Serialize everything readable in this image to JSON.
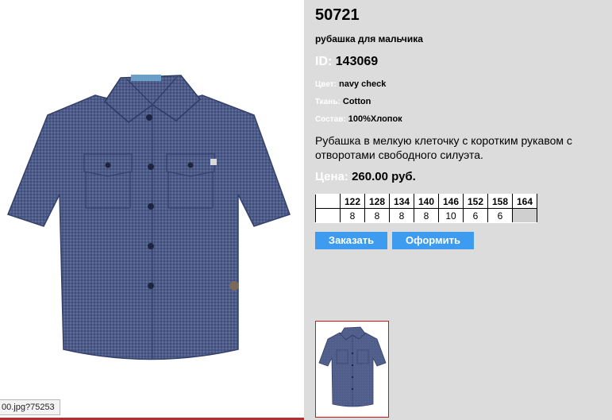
{
  "product": {
    "article": "50721",
    "name": "рубашка для мальчика",
    "id_label": "ID:",
    "id_value": "143069",
    "color_label": "Цвет:",
    "color_value": "navy check",
    "fabric_label": "Ткань:",
    "fabric_value": "Cotton",
    "composition_label": "Состав:",
    "composition_value": "100%Хлопок",
    "description": "Рубашка в мелкую клеточку с коротким рукавом с отворотами свободного силуэта.",
    "price_label": "Цена:",
    "price_value": "260.00 руб."
  },
  "sizes": {
    "headers": [
      "122",
      "128",
      "134",
      "140",
      "146",
      "152",
      "158",
      "164"
    ],
    "quantities": [
      "8",
      "8",
      "8",
      "8",
      "10",
      "6",
      "6",
      ""
    ]
  },
  "actions": {
    "order_label": "Заказать",
    "checkout_label": "Оформить"
  },
  "status_bar": {
    "url": "00.jpg?75253"
  },
  "colors": {
    "panel_bg": "#dcdcdc",
    "button_bg": "#3d9cf0",
    "thumb_border": "#dd1111",
    "shirt": "#4a5a86"
  }
}
